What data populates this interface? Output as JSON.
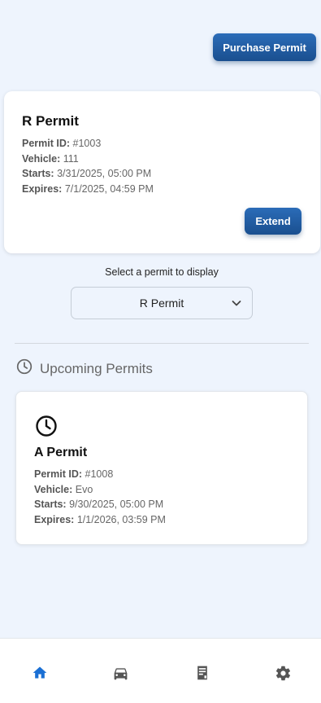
{
  "header": {
    "purchase_label": "Purchase Permit"
  },
  "current_permit": {
    "title": "R Permit",
    "id_label": "Permit ID:",
    "id_value": "#1003",
    "vehicle_label": "Vehicle:",
    "vehicle_value": "111",
    "starts_label": "Starts:",
    "starts_value": "3/31/2025, 05:00 PM",
    "expires_label": "Expires:",
    "expires_value": "7/1/2025, 04:59 PM",
    "extend_label": "Extend"
  },
  "selector": {
    "label": "Select a permit to display",
    "selected": "R Permit"
  },
  "upcoming": {
    "heading": "Upcoming Permits",
    "items": [
      {
        "title": "A Permit",
        "id_label": "Permit ID:",
        "id_value": "#1008",
        "vehicle_label": "Vehicle:",
        "vehicle_value": "Evo",
        "starts_label": "Starts:",
        "starts_value": "9/30/2025, 05:00 PM",
        "expires_label": "Expires:",
        "expires_value": "1/1/2026, 03:59 PM"
      }
    ]
  },
  "nav": {
    "items": [
      {
        "icon": "home-icon",
        "active": true
      },
      {
        "icon": "car-icon",
        "active": false
      },
      {
        "icon": "permit-document-icon",
        "active": false
      },
      {
        "icon": "gear-icon",
        "active": false
      }
    ]
  },
  "colors": {
    "accent": "#1f5fa8",
    "nav_active": "#1a6fd4",
    "nav_inactive": "#555555",
    "background": "#eef4fd"
  }
}
